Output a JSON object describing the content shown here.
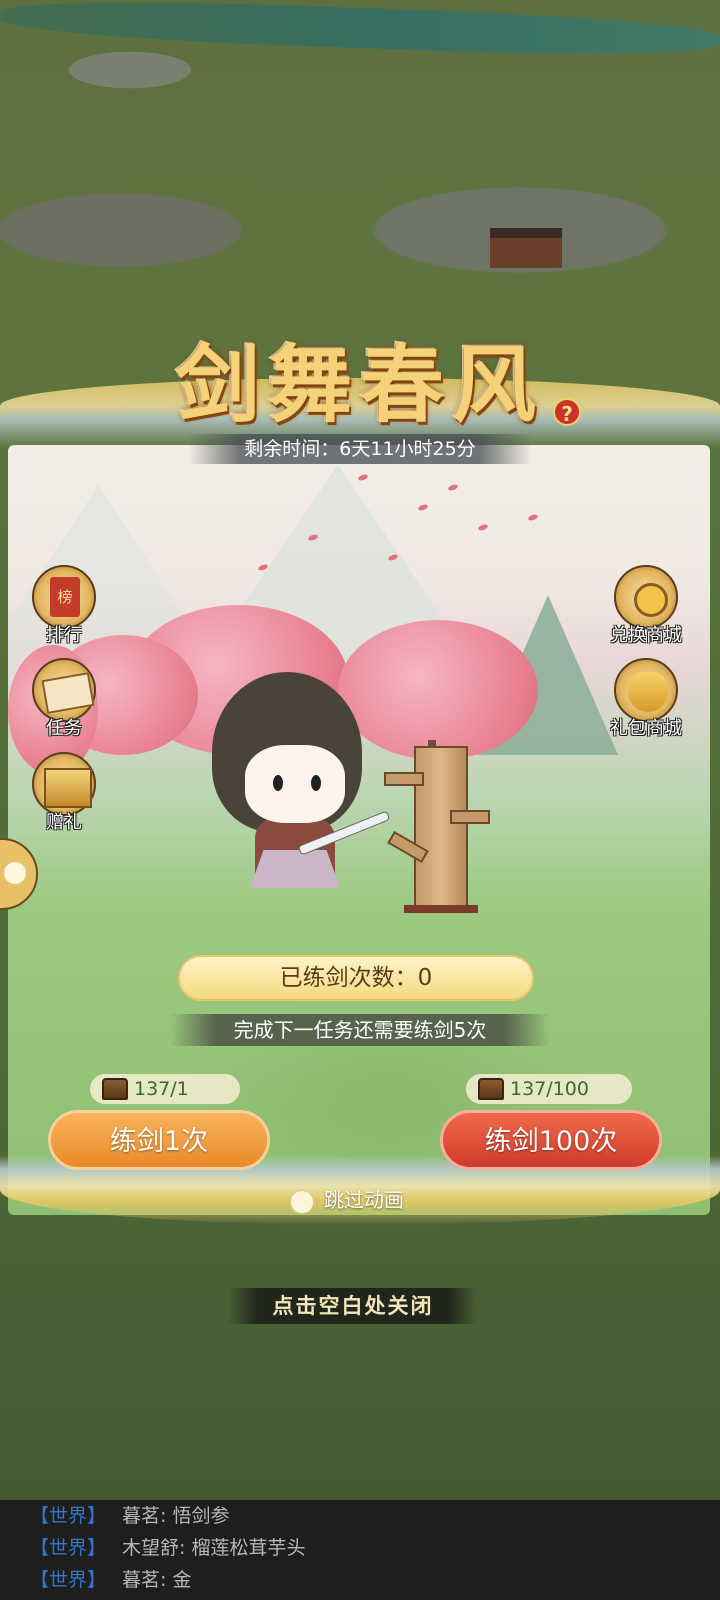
{
  "event": {
    "title": "剑舞春风",
    "remaining_time": "剩余时间：6天11小时25分"
  },
  "side_left": [
    {
      "label": "排行"
    },
    {
      "label": "任务"
    },
    {
      "label": "赠礼"
    }
  ],
  "side_right": [
    {
      "label": "兑换商城"
    },
    {
      "label": "礼包商城"
    }
  ],
  "practice": {
    "count_text": "已练剑次数：0",
    "next_task_hint": "完成下一任务还需要练剑5次",
    "cost_single": "137/1",
    "cost_hundred": "137/100",
    "btn_single": "练剑1次",
    "btn_hundred": "练剑100次",
    "skip_label": "跳过动画"
  },
  "close_hint": "点击空白处关闭",
  "chat": [
    {
      "channel": "【世界】",
      "text": "暮茗: 悟剑参"
    },
    {
      "channel": "【世界】",
      "text": "木望舒: 榴莲松茸芋头"
    },
    {
      "channel": "【世界】",
      "text": "暮茗: 金"
    }
  ],
  "colors": {
    "btn_single": "#ea8a2a",
    "btn_hundred": "#d03a2a",
    "title_gold": "#f5d27a",
    "chat_channel": "#3a73c8"
  }
}
